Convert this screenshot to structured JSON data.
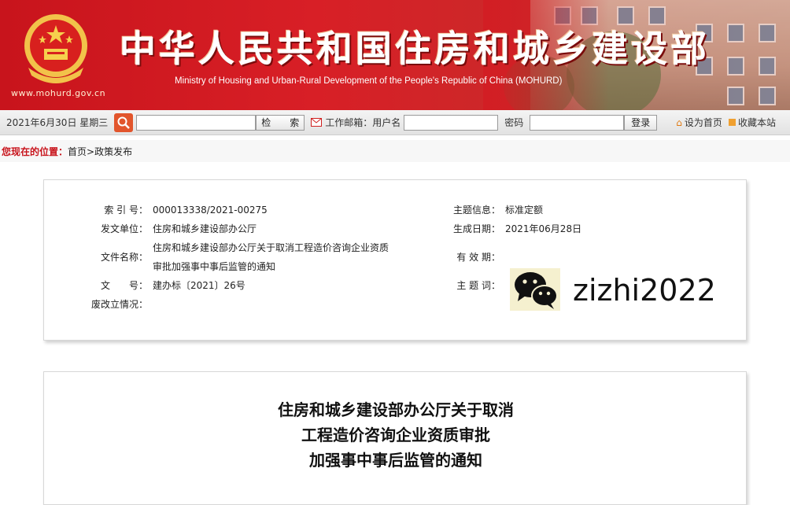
{
  "header": {
    "site_url": "www.mohurd.gov.cn",
    "title": "中华人民共和国住房和城乡建设部",
    "subtitle": "Ministry of Housing and Urban-Rural Development of the People's Republic of China (MOHURD)",
    "brand_color": "#d81f26"
  },
  "toolbar": {
    "date": "2021年6月30日 星期三",
    "search_placeholder": "",
    "search_button": "检　　索",
    "mail_label": "工作邮箱：用户名",
    "password_label": "密码",
    "login_button": "登录",
    "set_home": "设为首页",
    "bookmark": "收藏本站"
  },
  "breadcrumb": {
    "label": "您现在的位置：",
    "path": "首页>政策发布"
  },
  "info": {
    "index_key": "索 引 号：",
    "index_value": "000013338/2021-00275",
    "issuer_key": "发文单位：",
    "issuer_value": "住房和城乡建设部办公厅",
    "docname_key": "文件名称：",
    "docname_line1": "住房和城乡建设部办公厅关于取消工程造价咨询企业资质",
    "docname_line2": "审批加强事中事后监管的通知",
    "docno_key": "文　　号：",
    "docno_value": "建办标〔2021〕26号",
    "status_key": "废改立情况：",
    "status_value": "",
    "topic_key": "主题信息：",
    "topic_value": "标准定额",
    "date_key": "生成日期：",
    "date_value": "2021年06月28日",
    "valid_key": "有 效 期：",
    "valid_value": "",
    "keyword_key": "主 题 词：",
    "watermark_text": "zizhi2022"
  },
  "article": {
    "title_line1": "住房和城乡建设部办公厅关于取消",
    "title_line2": "工程造价咨询企业资质审批",
    "title_line3": "加强事中事后监管的通知"
  }
}
